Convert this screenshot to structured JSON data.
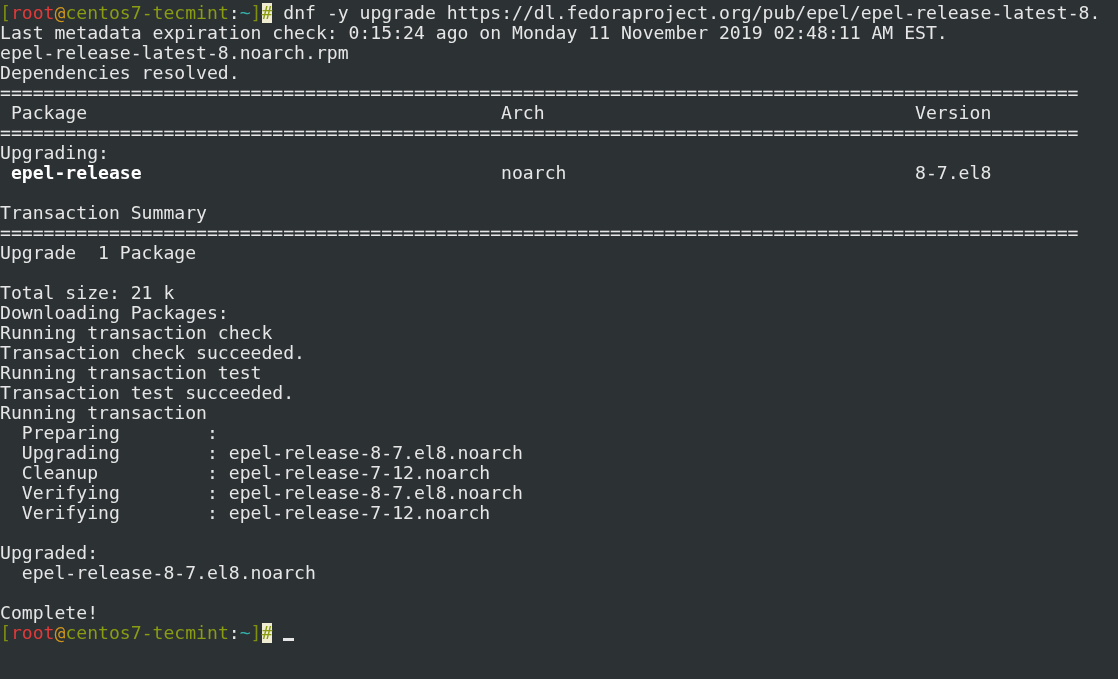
{
  "terminal": {
    "lines": [
      {
        "kind": "prompt",
        "open": "[",
        "user": "root",
        "at": "@",
        "host": "centos7-tecmint",
        "sep": ":",
        "path": "~",
        "close": "]",
        "symbol": "#",
        "command": "dnf -y upgrade https://dl.fedoraproject.org/pub/epel/epel-release-latest-8.",
        "cursor": false
      },
      {
        "kind": "text",
        "text": "Last metadata expiration check: 0:15:24 ago on Monday 11 November 2019 02:48:11 AM EST."
      },
      {
        "kind": "text",
        "text": "epel-release-latest-8.noarch.rpm"
      },
      {
        "kind": "text",
        "text": "Dependencies resolved."
      },
      {
        "kind": "rule",
        "text": "==================================================================================================="
      },
      {
        "kind": "row",
        "cells": [
          {
            "text": "Package",
            "bold": false
          },
          {
            "text": "Arch",
            "bold": false
          },
          {
            "text": "Version",
            "bold": false
          }
        ]
      },
      {
        "kind": "rule",
        "text": "==================================================================================================="
      },
      {
        "kind": "text",
        "text": "Upgrading:"
      },
      {
        "kind": "row",
        "cells": [
          {
            "text": "epel-release",
            "bold": true
          },
          {
            "text": "noarch",
            "bold": false
          },
          {
            "text": "8-7.el8",
            "bold": false
          }
        ]
      },
      {
        "kind": "blank"
      },
      {
        "kind": "text",
        "text": "Transaction Summary"
      },
      {
        "kind": "rule",
        "text": "==================================================================================================="
      },
      {
        "kind": "text",
        "text": "Upgrade  1 Package"
      },
      {
        "kind": "blank"
      },
      {
        "kind": "text",
        "text": "Total size: 21 k"
      },
      {
        "kind": "text",
        "text": "Downloading Packages:"
      },
      {
        "kind": "text",
        "text": "Running transaction check"
      },
      {
        "kind": "text",
        "text": "Transaction check succeeded."
      },
      {
        "kind": "text",
        "text": "Running transaction test"
      },
      {
        "kind": "text",
        "text": "Transaction test succeeded."
      },
      {
        "kind": "text",
        "text": "Running transaction"
      },
      {
        "kind": "text",
        "text": "  Preparing        :"
      },
      {
        "kind": "text",
        "text": "  Upgrading        : epel-release-8-7.el8.noarch"
      },
      {
        "kind": "text",
        "text": "  Cleanup          : epel-release-7-12.noarch"
      },
      {
        "kind": "text",
        "text": "  Verifying        : epel-release-8-7.el8.noarch"
      },
      {
        "kind": "text",
        "text": "  Verifying        : epel-release-7-12.noarch"
      },
      {
        "kind": "blank"
      },
      {
        "kind": "text",
        "text": "Upgraded:"
      },
      {
        "kind": "text",
        "text": "  epel-release-8-7.el8.noarch"
      },
      {
        "kind": "blank"
      },
      {
        "kind": "text",
        "text": "Complete!"
      },
      {
        "kind": "prompt",
        "open": "[",
        "user": "root",
        "at": "@",
        "host": "centos7-tecmint",
        "sep": ":",
        "path": "~",
        "close": "]",
        "symbol": "#",
        "cursor": true
      }
    ]
  }
}
